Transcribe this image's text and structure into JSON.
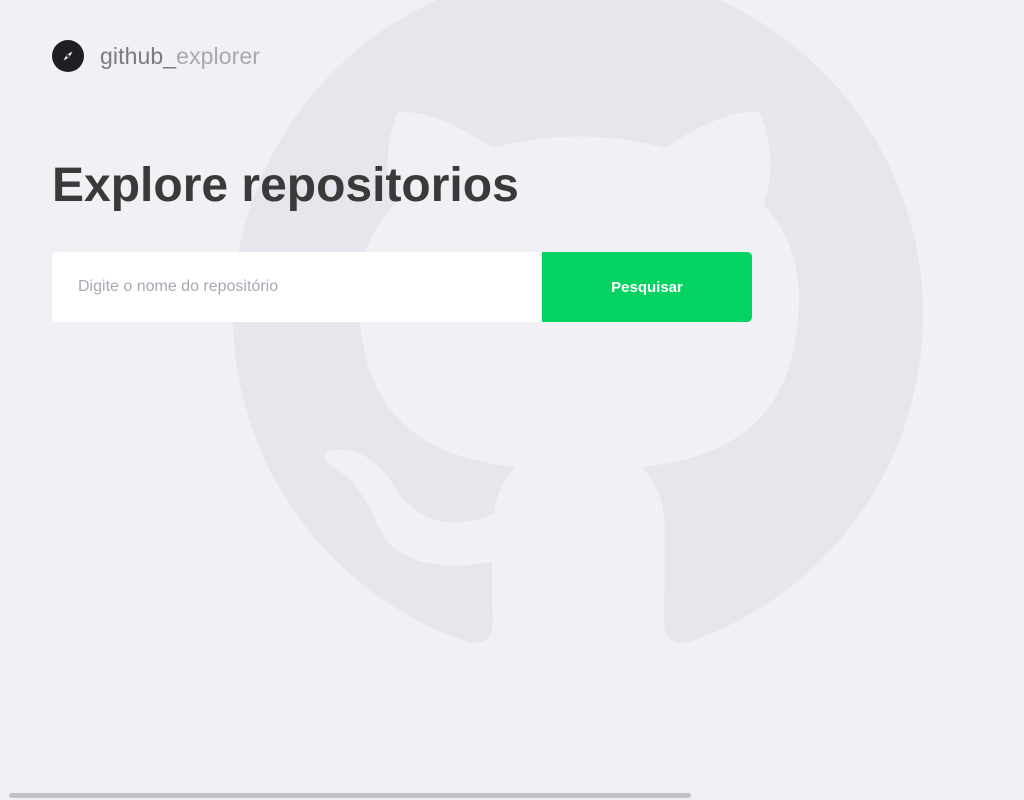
{
  "header": {
    "brand_icon": "compass-icon",
    "brand_main": "github_",
    "brand_secondary": "explorer"
  },
  "main": {
    "title": "Explore repositorios",
    "search": {
      "placeholder": "Digite o nome do repositório",
      "value": "",
      "button_label": "Pesquisar"
    }
  },
  "background": {
    "logo_icon": "github-octocat-icon"
  },
  "colors": {
    "background": "#f0f0f5",
    "accent": "#04d361",
    "title": "#3a3a3a",
    "brand_text": "#7a7a85",
    "brand_text_muted": "#a8a8b3",
    "placeholder": "#a8a8b3"
  }
}
